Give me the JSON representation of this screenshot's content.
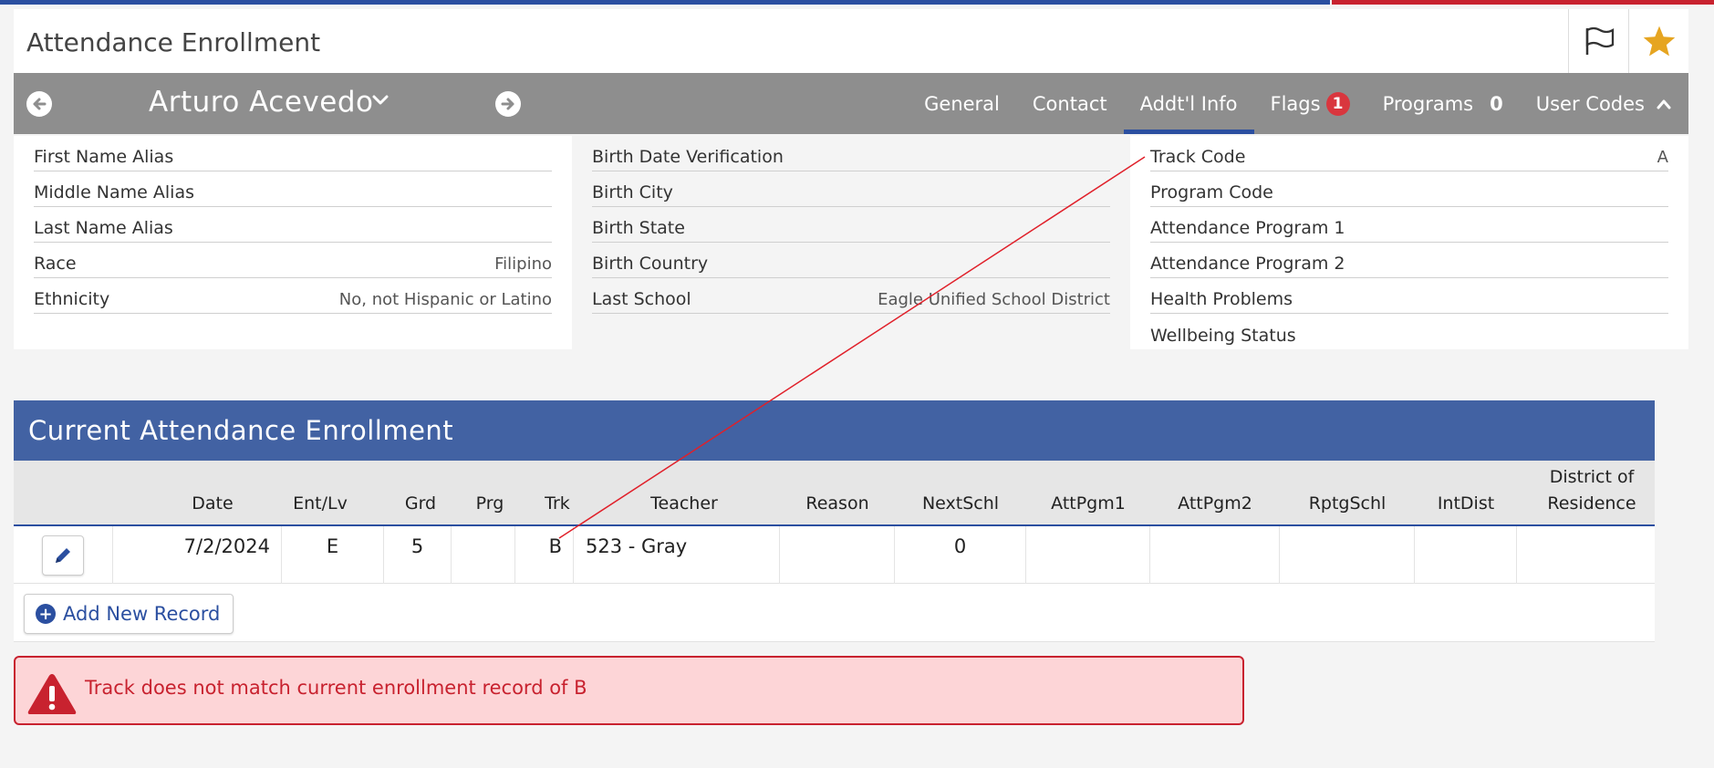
{
  "header": {
    "title": "Attendance Enrollment",
    "flag_icon": "flag-icon",
    "star_icon": "star-icon",
    "star_color": "#e6a521"
  },
  "student": {
    "name": "Arturo Acevedo"
  },
  "tabs": [
    {
      "label": "General",
      "active": false
    },
    {
      "label": "Contact",
      "active": false
    },
    {
      "label": "Addt'l Info",
      "active": true
    },
    {
      "label": "Flags",
      "badge": "1",
      "active": false
    },
    {
      "label": "Programs",
      "count": "0",
      "active": false
    },
    {
      "label": "User Codes",
      "active": false
    }
  ],
  "info": {
    "col1": [
      {
        "label": "First Name Alias",
        "value": ""
      },
      {
        "label": "Middle Name Alias",
        "value": ""
      },
      {
        "label": "Last Name Alias",
        "value": ""
      },
      {
        "label": "Race",
        "value": "Filipino"
      },
      {
        "label": "Ethnicity",
        "value": "No, not Hispanic or Latino"
      }
    ],
    "col2": [
      {
        "label": "Birth Date Verification",
        "value": ""
      },
      {
        "label": "Birth City",
        "value": ""
      },
      {
        "label": "Birth State",
        "value": ""
      },
      {
        "label": "Birth Country",
        "value": ""
      },
      {
        "label": "Last School",
        "value": "Eagle Unified School District"
      }
    ],
    "col3": [
      {
        "label": "Track Code",
        "value": "A"
      },
      {
        "label": "Program Code",
        "value": ""
      },
      {
        "label": "Attendance Program 1",
        "value": ""
      },
      {
        "label": "Attendance Program 2",
        "value": ""
      },
      {
        "label": "Health Problems",
        "value": ""
      },
      {
        "label": "Wellbeing Status",
        "value": ""
      }
    ]
  },
  "enrollment": {
    "title": "Current Attendance Enrollment",
    "columns": {
      "date": "Date",
      "entlv": "Ent/Lv",
      "grd": "Grd",
      "prg": "Prg",
      "trk": "Trk",
      "teacher": "Teacher",
      "reason": "Reason",
      "nextschl": "NextSchl",
      "attpgm1": "AttPgm1",
      "attpgm2": "AttPgm2",
      "rptgschl": "RptgSchl",
      "intdist": "IntDist",
      "district_line1": "District of",
      "district_line2": "Residence"
    },
    "row": {
      "date": "7/2/2024",
      "entlv": "E",
      "grd": "5",
      "prg": "",
      "trk": "B",
      "teacher": "523 - Gray",
      "reason": "",
      "nextschl": "0",
      "attpgm1": "",
      "attpgm2": "",
      "rptgschl": "",
      "intdist": "",
      "district": ""
    },
    "add_label": "Add New Record"
  },
  "alert": {
    "message": "Track does not match current enrollment record of B",
    "color": "#c8222f"
  },
  "accent": "#2b4fa0"
}
